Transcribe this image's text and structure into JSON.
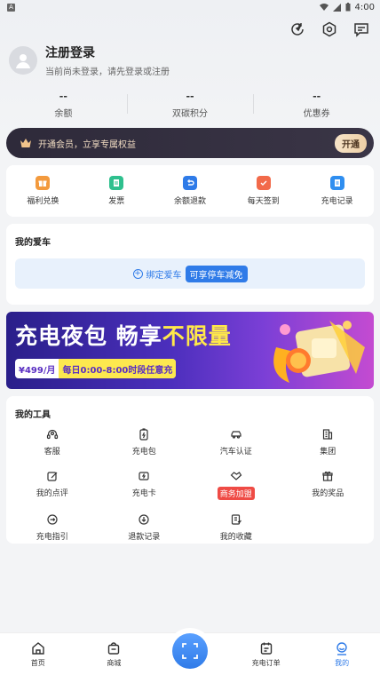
{
  "status": {
    "time": "4:00",
    "carrier_icon": "A"
  },
  "profile": {
    "name": "注册登录",
    "subtitle": "当前尚未登录，请先登录或注册"
  },
  "stats": [
    {
      "value": "--",
      "label": "余额"
    },
    {
      "value": "--",
      "label": "双碳积分"
    },
    {
      "value": "--",
      "label": "优惠券"
    }
  ],
  "vip": {
    "text": "开通会员，立享专属权益",
    "button": "开通"
  },
  "quick": [
    {
      "label": "福利兑换",
      "color": "#f39a3d"
    },
    {
      "label": "发票",
      "color": "#2fc08e"
    },
    {
      "label": "余额退款",
      "color": "#2f7be8"
    },
    {
      "label": "每天签到",
      "color": "#f26a4a"
    },
    {
      "label": "充电记录",
      "color": "#2f8ef0"
    }
  ],
  "car": {
    "title": "我的爱车",
    "bind_text": "绑定爱车",
    "bind_badge": "可享停车减免"
  },
  "banner": {
    "title_part1": "充电夜包  畅享",
    "title_highlight": "不限量",
    "price": "¥499/月",
    "desc": "每日0:00-8:00时段任意充"
  },
  "tools": {
    "title": "我的工具",
    "items": [
      {
        "label": "客服",
        "icon": "headset-icon"
      },
      {
        "label": "充电包",
        "icon": "battery-pack-icon"
      },
      {
        "label": "汽车认证",
        "icon": "car-cert-icon"
      },
      {
        "label": "集团",
        "icon": "building-icon"
      },
      {
        "label": "我的点评",
        "icon": "review-icon"
      },
      {
        "label": "充电卡",
        "icon": "charge-card-icon"
      },
      {
        "label": "商务加盟",
        "icon": "handshake-icon",
        "badge": true
      },
      {
        "label": "我的奖品",
        "icon": "gift-icon"
      },
      {
        "label": "充电指引",
        "icon": "guide-icon"
      },
      {
        "label": "退款记录",
        "icon": "refund-icon"
      },
      {
        "label": "我的收藏",
        "icon": "favorite-icon"
      }
    ]
  },
  "tabbar": {
    "home": "首页",
    "mall": "商城",
    "orders": "充电订单",
    "mine": "我的"
  },
  "colors": {
    "accent": "#2f7be8",
    "vip_bg": "#2e2a3a",
    "badge": "#ef4b45"
  }
}
